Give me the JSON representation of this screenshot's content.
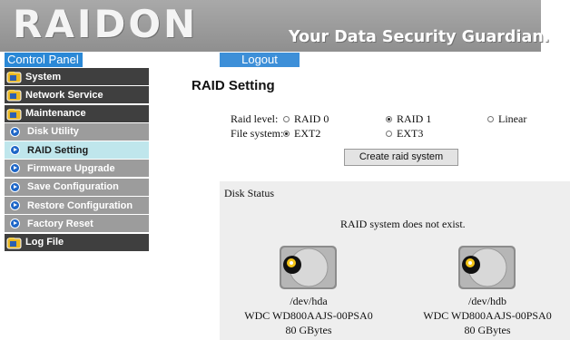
{
  "header": {
    "logo": "RAIDON",
    "tagline": "Your Data Security Guardian."
  },
  "nav": {
    "control_panel": "Control Panel",
    "logout": "Logout"
  },
  "sidebar": {
    "items": [
      {
        "label": "System",
        "kind": "folder",
        "icon": "folder-icon"
      },
      {
        "label": "Network Service",
        "kind": "folder",
        "icon": "folder-icon"
      },
      {
        "label": "Maintenance",
        "kind": "folder",
        "icon": "folder-icon"
      },
      {
        "label": "Disk Utility",
        "kind": "sub",
        "icon": "arrow-icon"
      },
      {
        "label": "RAID Setting",
        "kind": "sub-active",
        "icon": "arrow-icon"
      },
      {
        "label": "Firmware Upgrade",
        "kind": "sub",
        "icon": "arrow-icon"
      },
      {
        "label": "Save Configuration",
        "kind": "sub",
        "icon": "arrow-icon"
      },
      {
        "label": "Restore Configuration",
        "kind": "sub",
        "icon": "arrow-icon"
      },
      {
        "label": "Factory Reset",
        "kind": "sub",
        "icon": "arrow-icon"
      },
      {
        "label": "Log File",
        "kind": "folder",
        "icon": "folder-icon"
      }
    ]
  },
  "main": {
    "title": "RAID Setting",
    "raid_level_label": "Raid level:",
    "raid_options": [
      {
        "label": "RAID 0",
        "selected": false
      },
      {
        "label": "RAID 1",
        "selected": true
      },
      {
        "label": "Linear",
        "selected": false
      }
    ],
    "file_system_label": "File system:",
    "fs_options": [
      {
        "label": "EXT2",
        "selected": true
      },
      {
        "label": "EXT3",
        "selected": false
      }
    ],
    "create_button": "Create raid system",
    "disk_status": {
      "title": "Disk Status",
      "message": "RAID system does not exist.",
      "disks": [
        {
          "device": "/dev/hda",
          "model": "WDC WD800AAJS-00PSA0",
          "size": "80 GBytes"
        },
        {
          "device": "/dev/hdb",
          "model": "WDC WD800AAJS-00PSA0",
          "size": "80 GBytes"
        }
      ]
    }
  },
  "colors": {
    "header_gray": "#999999",
    "accent_blue": "#2a88d6",
    "menu_dark": "#3f3f3f",
    "menu_sub": "#9c9c9c",
    "menu_active": "#bfe6ec"
  }
}
